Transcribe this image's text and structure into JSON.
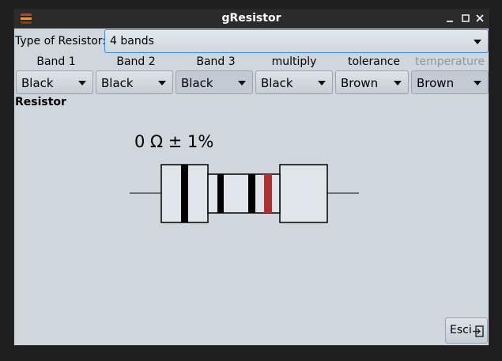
{
  "window": {
    "title": "gResistor"
  },
  "type": {
    "label": "Type of  Resistor:",
    "value": "4 bands"
  },
  "bands": [
    {
      "label": "Band 1",
      "value": "Black",
      "enabled": true
    },
    {
      "label": "Band 2",
      "value": "Black",
      "enabled": true
    },
    {
      "label": "Band 3",
      "value": "Black",
      "enabled": false
    },
    {
      "label": "multiply",
      "value": "Black",
      "enabled": true
    },
    {
      "label": "tolerance",
      "value": "Brown",
      "enabled": true
    },
    {
      "label": "temperature",
      "value": "Brown",
      "enabled": false
    }
  ],
  "resistor": {
    "section_label": "Resistor",
    "value_text": "0 Ω ± 1%",
    "band_colors": {
      "black": "#000000",
      "brown": "#b03030"
    }
  },
  "footer": {
    "exit_label": "Esci"
  },
  "icons": {
    "app": "resistor-app-icon",
    "minimize": "minimize-icon",
    "maximize": "maximize-icon",
    "close": "close-icon",
    "exit": "exit-icon"
  },
  "colors": {
    "titlebar": "#2b2b2b",
    "window_bg": "#cfd6dc",
    "focus": "#3d8ee0"
  }
}
